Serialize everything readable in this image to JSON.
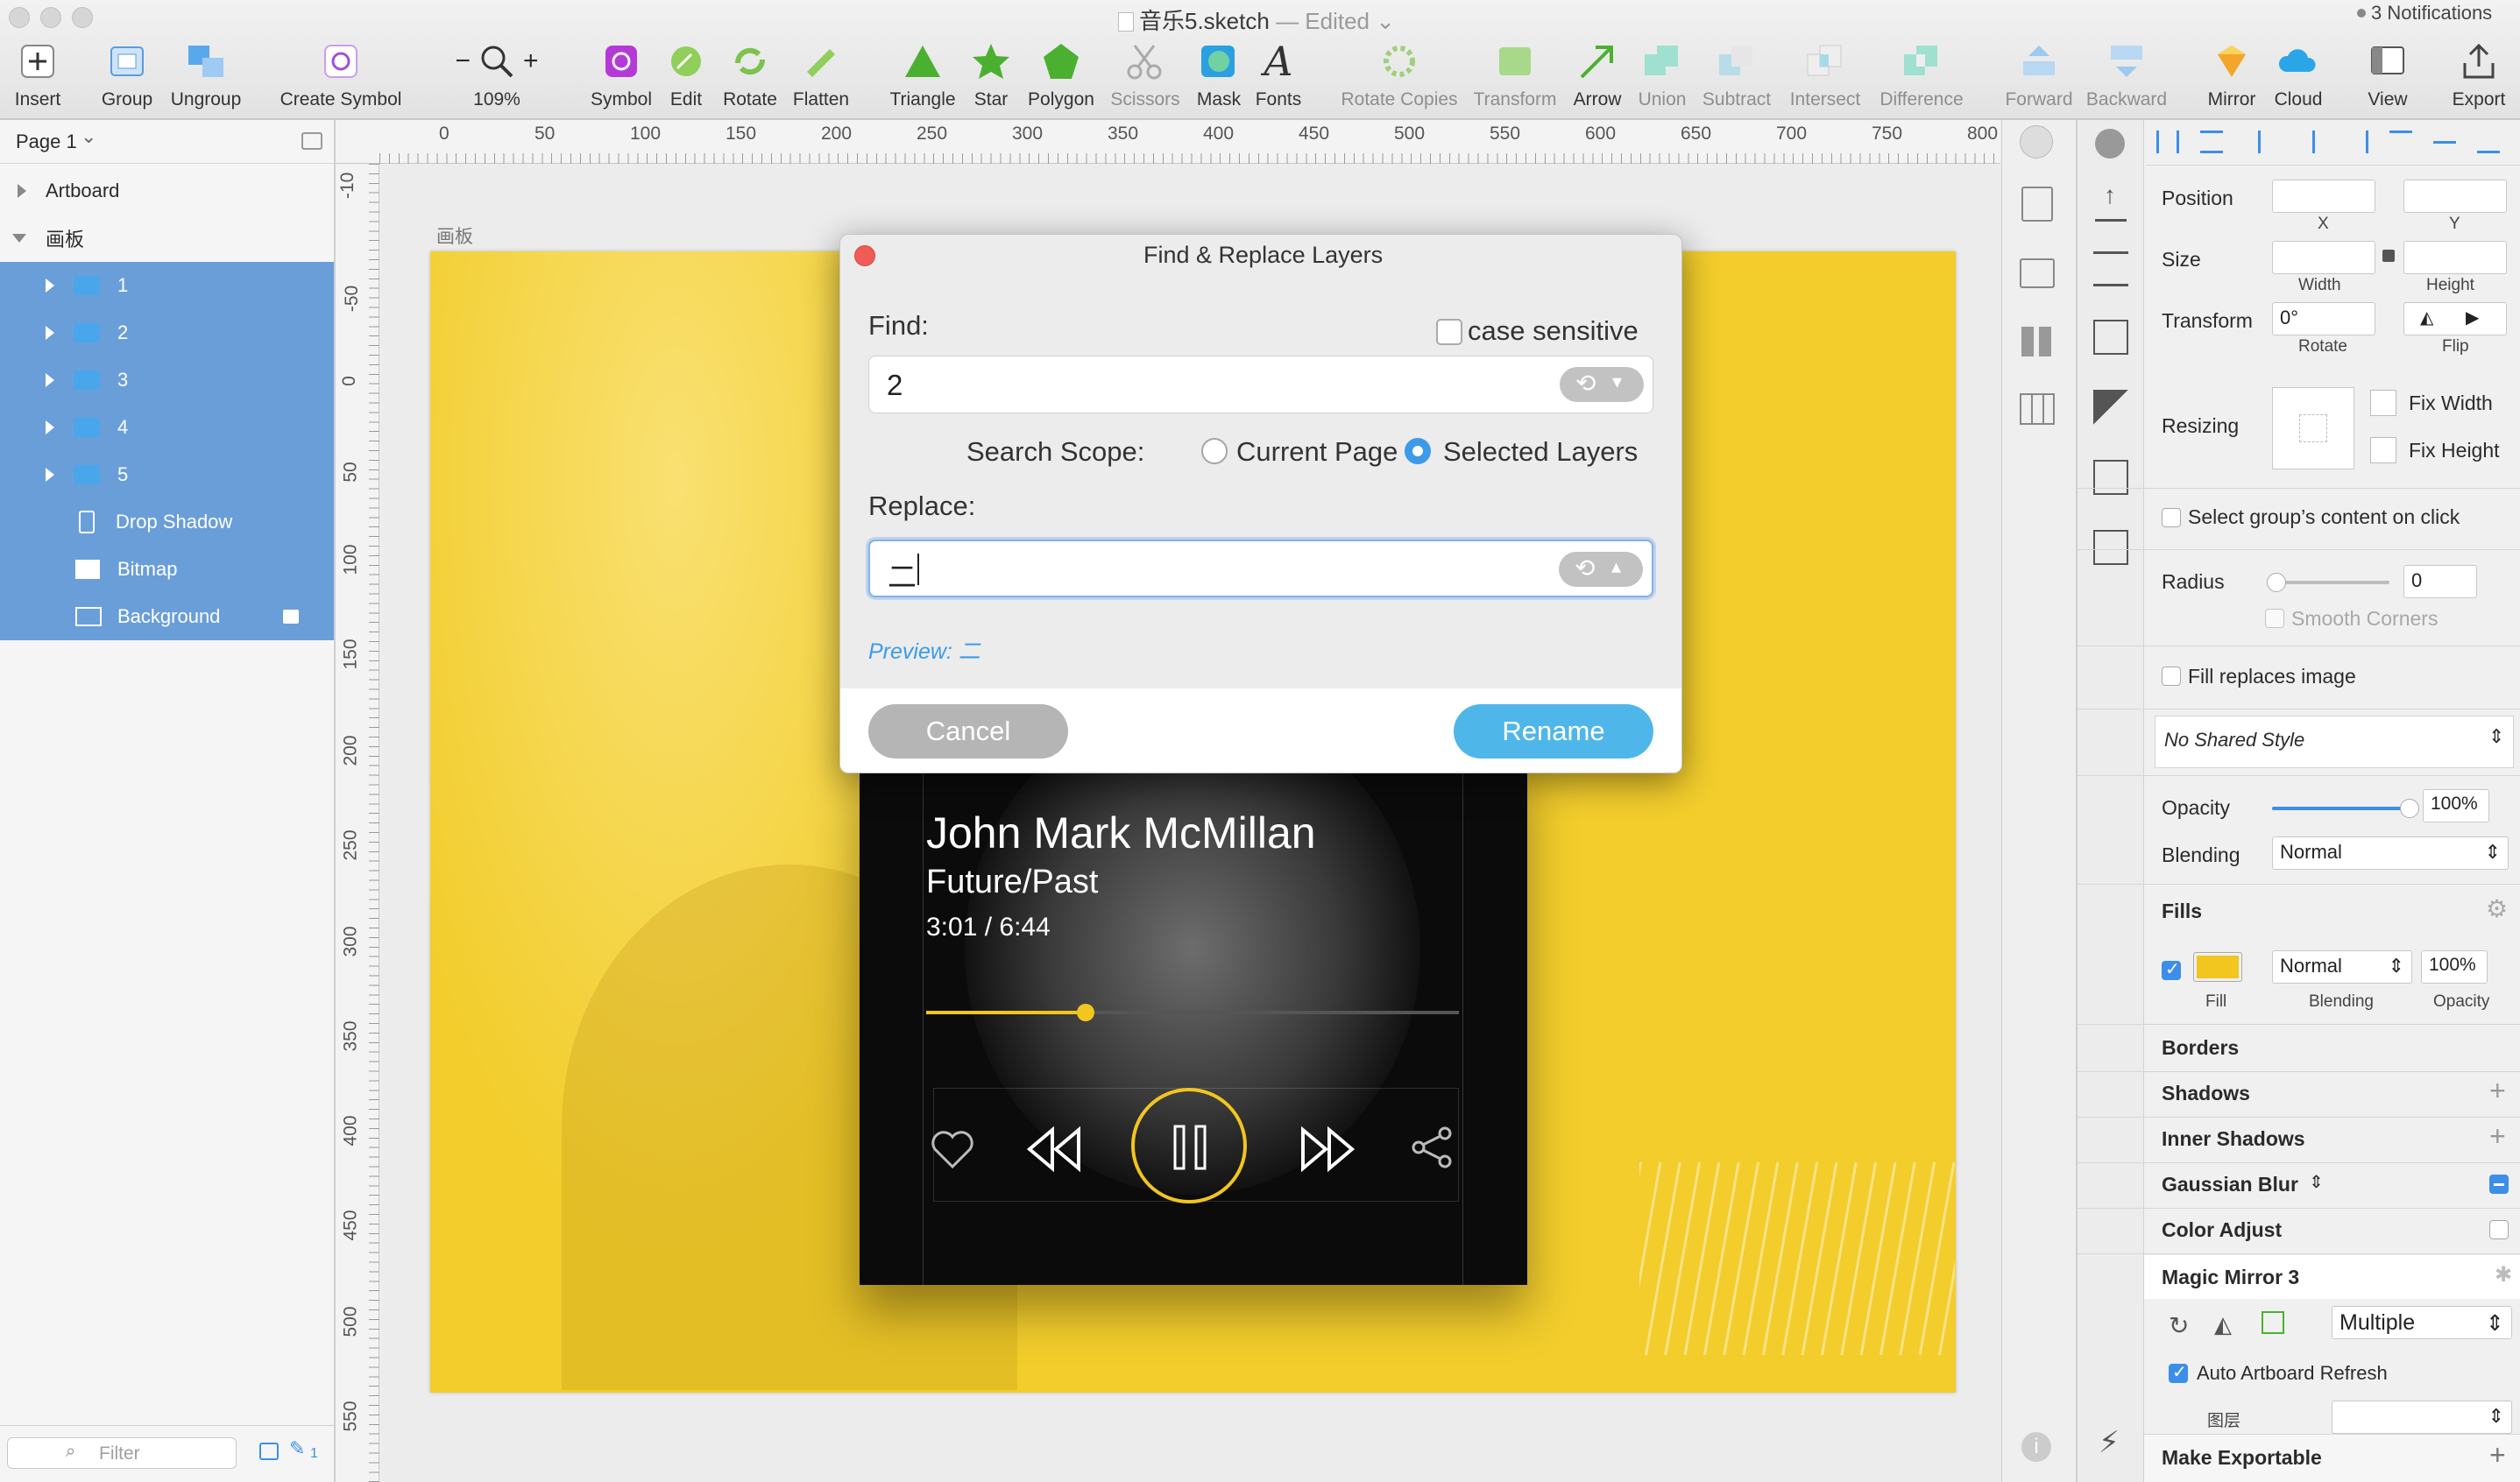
{
  "window": {
    "doc_name": "音乐5.sketch",
    "edited": "— Edited",
    "notifications": "3 Notifications"
  },
  "toolbar": {
    "insert": "Insert",
    "group": "Group",
    "ungroup": "Ungroup",
    "create_symbol": "Create Symbol",
    "zoom": "109%",
    "symbol": "Symbol",
    "edit": "Edit",
    "rotate": "Rotate",
    "flatten": "Flatten",
    "triangle": "Triangle",
    "star": "Star",
    "polygon": "Polygon",
    "scissors": "Scissors",
    "mask": "Mask",
    "fonts": "Fonts",
    "rotate_copies": "Rotate Copies",
    "transform": "Transform",
    "arrow": "Arrow",
    "union": "Union",
    "subtract": "Subtract",
    "intersect": "Intersect",
    "difference": "Difference",
    "forward": "Forward",
    "backward": "Backward",
    "mirror": "Mirror",
    "cloud": "Cloud",
    "view": "View",
    "export": "Export"
  },
  "layers": {
    "page": "Page 1",
    "artboard": "Artboard",
    "group_name": "画板",
    "items": [
      "1",
      "2",
      "3",
      "4",
      "5",
      "Drop Shadow",
      "Bitmap",
      "Background"
    ],
    "filter_placeholder": "Filter",
    "filter_count": "1"
  },
  "rulers": {
    "top": [
      "0",
      "50",
      "100",
      "150",
      "200",
      "250",
      "300",
      "350",
      "400",
      "450",
      "500",
      "550",
      "600",
      "650",
      "700",
      "750",
      "800"
    ],
    "left": [
      "-10",
      "-50",
      "0",
      "50",
      "100",
      "150",
      "200",
      "250",
      "300",
      "350",
      "400",
      "450",
      "500",
      "550"
    ]
  },
  "canvas": {
    "artboard_label": "画板"
  },
  "player": {
    "artist": "John Mark McMillan",
    "album": "Future/Past",
    "time": "3:01 / 6:44",
    "progress": 0.3,
    "accent": "#f2c51f"
  },
  "dialog": {
    "title": "Find & Replace Layers",
    "find_label": "Find:",
    "case_sensitive": "case sensitive",
    "find_value": "2",
    "search_scope": "Search Scope:",
    "scope_current": "Current Page",
    "scope_selected": "Selected Layers",
    "replace_label": "Replace:",
    "replace_value": "二",
    "preview": "Preview: 二",
    "cancel": "Cancel",
    "rename": "Rename"
  },
  "inspector": {
    "position": "Position",
    "x": "X",
    "y": "Y",
    "size": "Size",
    "width": "Width",
    "height": "Height",
    "transform": "Transform",
    "rotate_value": "0°",
    "rotate": "Rotate",
    "flip": "Flip",
    "resizing": "Resizing",
    "fix_width": "Fix Width",
    "fix_height": "Fix Height",
    "select_group": "Select group’s content on click",
    "radius": "Radius",
    "radius_value": "0",
    "smooth_corners": "Smooth Corners",
    "fill_replaces": "Fill replaces image",
    "shared_style": "No Shared Style",
    "opacity": "Opacity",
    "opacity_value": "100%",
    "blending": "Blending",
    "blending_value": "Normal",
    "fills": "Fills",
    "fill_color": "#f2c51f",
    "fill_label": "Fill",
    "fill_blending": "Normal",
    "fill_blending_label": "Blending",
    "fill_opacity": "100%",
    "fill_opacity_label": "Opacity",
    "borders": "Borders",
    "shadows": "Shadows",
    "inner_shadows": "Inner Shadows",
    "gaussian_blur": "Gaussian Blur",
    "color_adjust": "Color Adjust",
    "magic_mirror": "Magic Mirror 3",
    "multiple": "Multiple",
    "auto_refresh": "Auto Artboard Refresh",
    "layer_cn": "图层",
    "make_exportable": "Make Exportable"
  }
}
